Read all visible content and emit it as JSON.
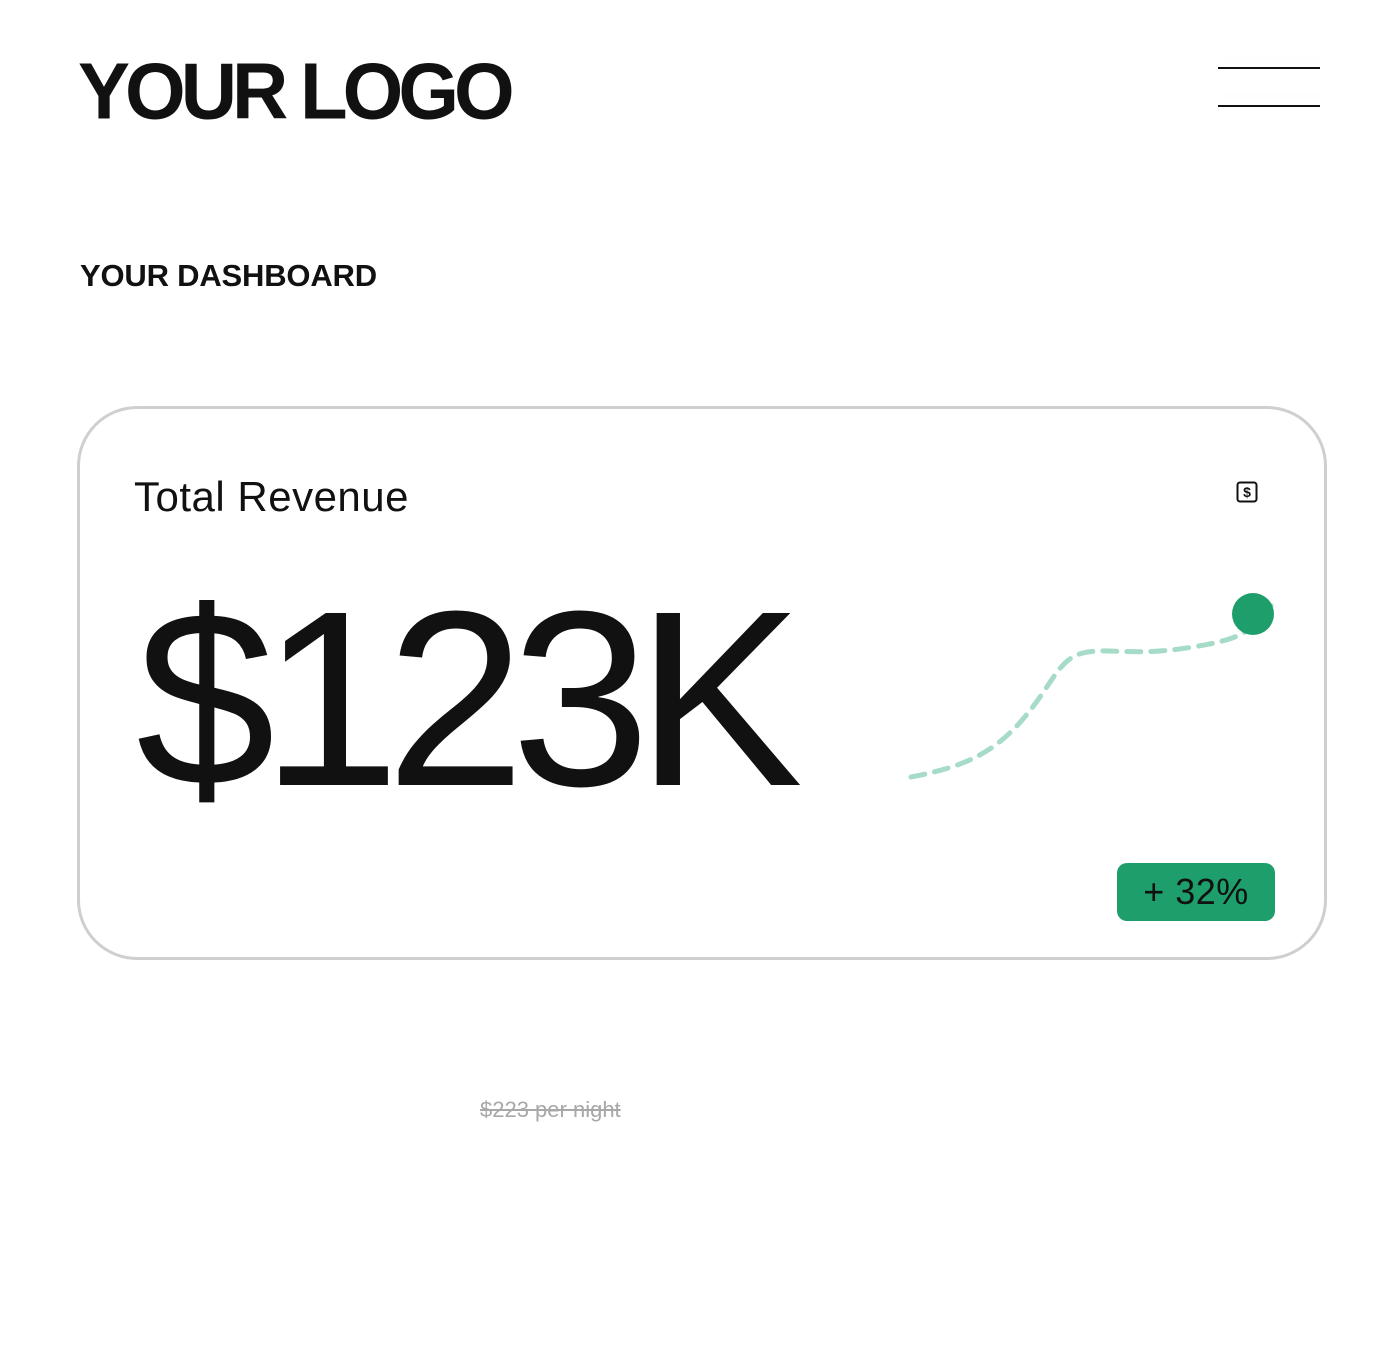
{
  "header": {
    "logo_text": "YOUR LOGO",
    "menu_icon": "hamburger-menu-icon"
  },
  "page": {
    "title": "YOUR DASHBOARD"
  },
  "revenue_card": {
    "label": "Total Revenue",
    "icon": "dollar-sign-icon",
    "value": "$123K",
    "change": "+ 32%",
    "trend_color": "#1e9e6a",
    "trend_line_color": "#a6dbc7"
  },
  "footnote": {
    "text": "$223 per night"
  },
  "colors": {
    "accent": "#1e9e6a",
    "text": "#111111",
    "muted": "#a8a8a8",
    "border": "#cfcfcf"
  }
}
